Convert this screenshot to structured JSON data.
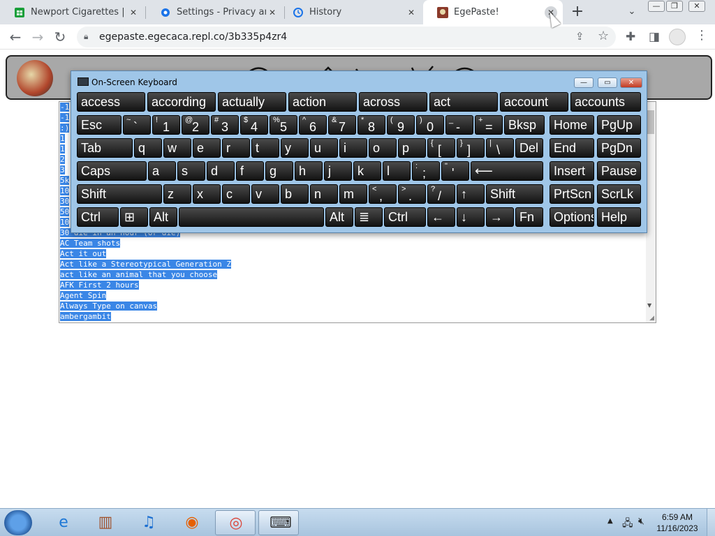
{
  "tabs": [
    {
      "title": "Newport Cigarettes | Save",
      "close": "✕",
      "favicon_color": "#1a9f3a"
    },
    {
      "title": "Settings - Privacy and sec",
      "close": "✕",
      "favicon_color": "#1a73e8"
    },
    {
      "title": "History",
      "close": "✕",
      "favicon_color": "#1a73e8"
    },
    {
      "title": "EgePaste!",
      "close": "✕",
      "favicon_color": "#8b3a2a"
    }
  ],
  "address_bar": {
    "url": "egepaste.egecaca.repl.co/3b335p4zr4"
  },
  "paste": {
    "lines": [
      "-1",
      "-1",
      ":)",
      "1",
      "1",
      "2",
      "3",
      "5k",
      "10",
      "30",
      "50",
      "10",
      "30 die in an hour (or die)",
      "AC Team shots",
      "Act it out",
      "Act like a Stereotypical Generation Z",
      "act like an animal that you choose",
      "AFK First 2 hours",
      "Agent Spin",
      "Always Type on canvas",
      "ambergambit"
    ]
  },
  "keyboard": {
    "title": "On-Screen Keyboard",
    "suggestions": [
      "access",
      "according",
      "actually",
      "action",
      "across",
      "act",
      "account",
      "accounts"
    ],
    "row1": [
      {
        "sup": "",
        "main": "Esc"
      },
      {
        "sup": "~",
        "main": "`"
      },
      {
        "sup": "!",
        "main": "1"
      },
      {
        "sup": "@",
        "main": "2"
      },
      {
        "sup": "#",
        "main": "3"
      },
      {
        "sup": "$",
        "main": "4"
      },
      {
        "sup": "%",
        "main": "5"
      },
      {
        "sup": "^",
        "main": "6"
      },
      {
        "sup": "&",
        "main": "7"
      },
      {
        "sup": "*",
        "main": "8"
      },
      {
        "sup": "(",
        "main": "9"
      },
      {
        "sup": ")",
        "main": "0"
      },
      {
        "sup": "_",
        "main": "-"
      },
      {
        "sup": "+",
        "main": "="
      },
      {
        "sup": "",
        "main": "Bksp"
      },
      {
        "sup": "",
        "main": "Home"
      },
      {
        "sup": "",
        "main": "PgUp"
      }
    ],
    "row2": [
      {
        "sup": "",
        "main": "Tab"
      },
      {
        "sup": "",
        "main": "q"
      },
      {
        "sup": "",
        "main": "w"
      },
      {
        "sup": "",
        "main": "e"
      },
      {
        "sup": "",
        "main": "r"
      },
      {
        "sup": "",
        "main": "t"
      },
      {
        "sup": "",
        "main": "y"
      },
      {
        "sup": "",
        "main": "u"
      },
      {
        "sup": "",
        "main": "i"
      },
      {
        "sup": "",
        "main": "o"
      },
      {
        "sup": "",
        "main": "p"
      },
      {
        "sup": "{",
        "main": "["
      },
      {
        "sup": "}",
        "main": "]"
      },
      {
        "sup": "|",
        "main": "\\"
      },
      {
        "sup": "",
        "main": "Del"
      },
      {
        "sup": "",
        "main": "End"
      },
      {
        "sup": "",
        "main": "PgDn"
      }
    ],
    "row3": [
      {
        "sup": "",
        "main": "Caps"
      },
      {
        "sup": "",
        "main": "a"
      },
      {
        "sup": "",
        "main": "s"
      },
      {
        "sup": "",
        "main": "d"
      },
      {
        "sup": "",
        "main": "f"
      },
      {
        "sup": "",
        "main": "g"
      },
      {
        "sup": "",
        "main": "h"
      },
      {
        "sup": "",
        "main": "j"
      },
      {
        "sup": "",
        "main": "k"
      },
      {
        "sup": "",
        "main": "l"
      },
      {
        "sup": ":",
        "main": ";"
      },
      {
        "sup": "\"",
        "main": "'"
      },
      {
        "sup": "",
        "main": "⟵"
      },
      {
        "sup": "",
        "main": "Insert"
      },
      {
        "sup": "",
        "main": "Pause"
      }
    ],
    "row4": [
      {
        "sup": "",
        "main": "Shift"
      },
      {
        "sup": "",
        "main": "z"
      },
      {
        "sup": "",
        "main": "x"
      },
      {
        "sup": "",
        "main": "c"
      },
      {
        "sup": "",
        "main": "v"
      },
      {
        "sup": "",
        "main": "b"
      },
      {
        "sup": "",
        "main": "n"
      },
      {
        "sup": "",
        "main": "m"
      },
      {
        "sup": "<",
        "main": ","
      },
      {
        "sup": ">",
        "main": "."
      },
      {
        "sup": "?",
        "main": "/"
      },
      {
        "sup": "",
        "main": "↑"
      },
      {
        "sup": "",
        "main": "Shift"
      },
      {
        "sup": "",
        "main": "PrtScn"
      },
      {
        "sup": "",
        "main": "ScrLk"
      }
    ],
    "row5": [
      {
        "sup": "",
        "main": "Ctrl"
      },
      {
        "sup": "",
        "main": "⊞"
      },
      {
        "sup": "",
        "main": "Alt"
      },
      {
        "sup": "",
        "main": ""
      },
      {
        "sup": "",
        "main": "Alt"
      },
      {
        "sup": "",
        "main": "≣"
      },
      {
        "sup": "",
        "main": "Ctrl"
      },
      {
        "sup": "",
        "main": "←"
      },
      {
        "sup": "",
        "main": "↓"
      },
      {
        "sup": "",
        "main": "→"
      },
      {
        "sup": "",
        "main": "Fn"
      },
      {
        "sup": "",
        "main": "Options"
      },
      {
        "sup": "",
        "main": "Help"
      }
    ]
  },
  "taskbar": {
    "items": [
      {
        "name": "internet-explorer-icon",
        "glyph": "e",
        "color": "#1e78d6"
      },
      {
        "name": "archive-app-icon",
        "glyph": "▥",
        "color": "#a0522d"
      },
      {
        "name": "music-player-icon",
        "glyph": "♫",
        "color": "#1c6fd1"
      },
      {
        "name": "firefox-icon",
        "glyph": "◉",
        "color": "#e66000"
      },
      {
        "name": "chrome-icon",
        "glyph": "◎",
        "color": "#db4437"
      },
      {
        "name": "on-screen-keyboard-icon",
        "glyph": "⌨",
        "color": "#333333"
      }
    ],
    "time": "6:59 AM",
    "date": "11/16/2023"
  }
}
